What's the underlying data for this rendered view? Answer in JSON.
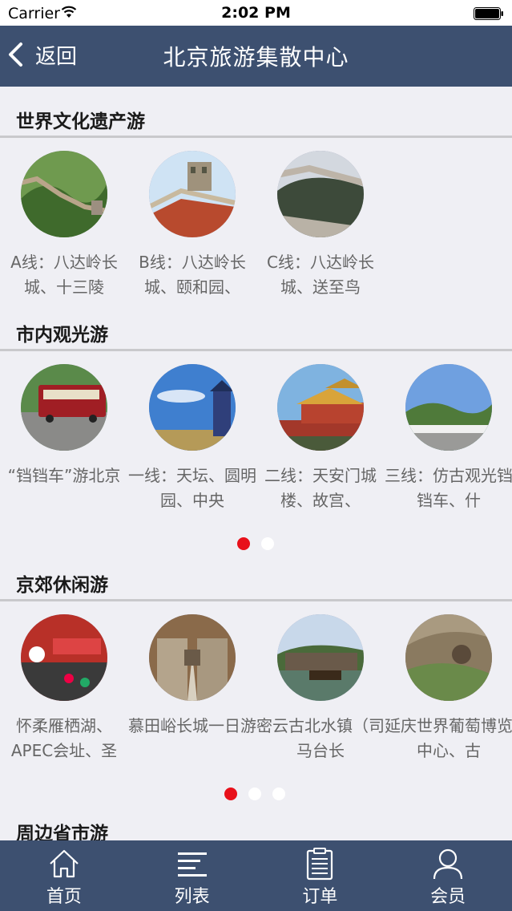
{
  "status_bar": {
    "carrier": "Carrier",
    "time": "2:02 PM"
  },
  "nav": {
    "back_label": "返回",
    "title": "北京旅游集散中心"
  },
  "sections": [
    {
      "title": "世界文化遗产游",
      "items": [
        {
          "label": "A线：八达岭长城、十三陵"
        },
        {
          "label": "B线：八达岭长城、颐和园、"
        },
        {
          "label": "C线：八达岭长城、送至鸟"
        }
      ]
    },
    {
      "title": "市内观光游",
      "items": [
        {
          "label": "“铛铛车”游北京"
        },
        {
          "label": "一线：天坛、圆明园、中央"
        },
        {
          "label": "二线：天安门城楼、故宫、"
        },
        {
          "label": "三线：仿古观光铛铛车、什"
        }
      ],
      "page_count": 2,
      "current_page": 1
    },
    {
      "title": "京郊休闲游",
      "items": [
        {
          "label": "怀柔雁栖湖、APEC会址、圣"
        },
        {
          "label": "慕田峪长城一日游"
        },
        {
          "label": "密云古北水镇（司马台长"
        },
        {
          "label": "延庆世界葡萄博览中心、古"
        }
      ],
      "page_count": 3,
      "current_page": 1
    },
    {
      "title": "周边省市游"
    }
  ],
  "tab_bar": {
    "tabs": [
      {
        "label": "首页",
        "icon": "home-icon"
      },
      {
        "label": "列表",
        "icon": "list-icon"
      },
      {
        "label": "订单",
        "icon": "clipboard-icon"
      },
      {
        "label": "会员",
        "icon": "person-icon"
      }
    ]
  },
  "colors": {
    "nav_bg": "#3d5070",
    "active_dot": "#e8101a",
    "page_bg": "#efeff4"
  }
}
